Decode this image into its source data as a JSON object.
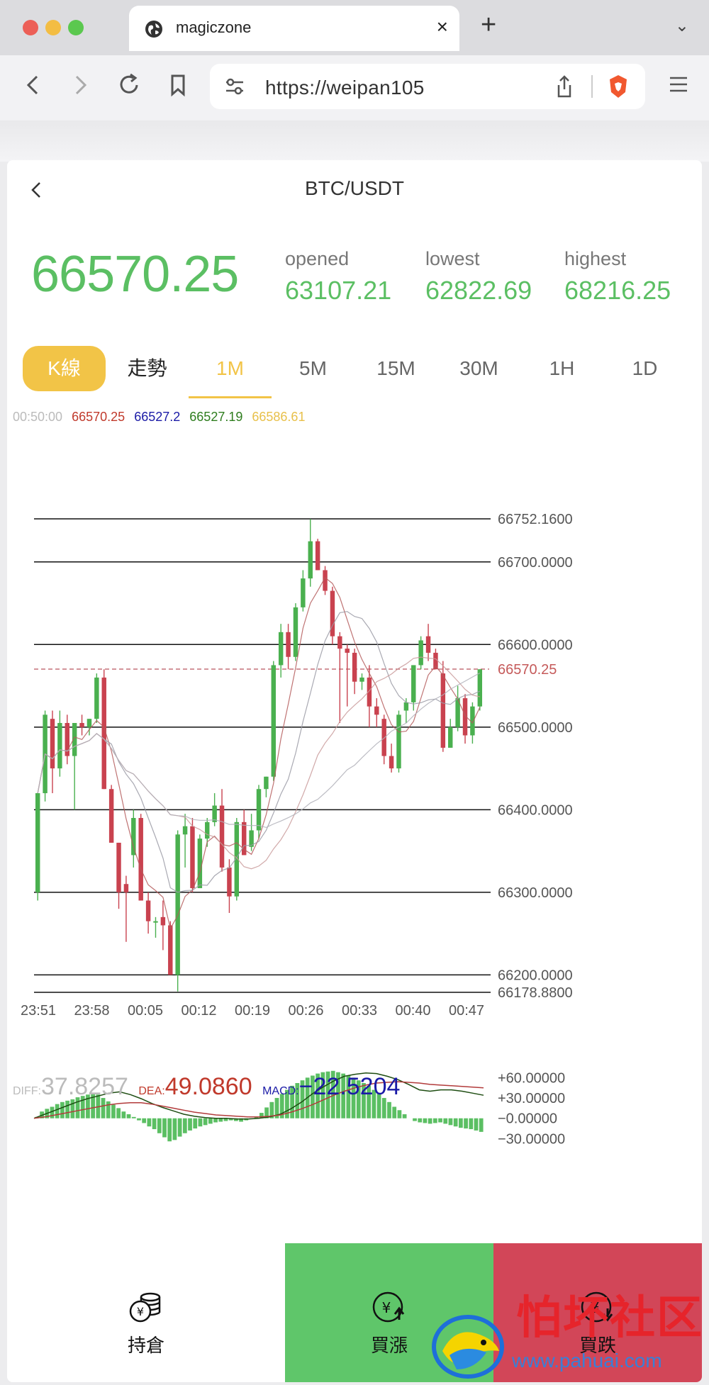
{
  "browser": {
    "tab_title": "magiczone",
    "tab_close": "×",
    "new_tab": "+",
    "tab_menu": "⌄",
    "url": "https://weipan105",
    "icons": [
      "globe-icon",
      "back-arrow-icon",
      "forward-arrow-icon",
      "reload-icon",
      "bookmark-icon",
      "site-settings-icon",
      "share-icon",
      "brave-shield-icon",
      "menu-icon"
    ],
    "traffic_colors": [
      "#ec5f57",
      "#f3bd43",
      "#5bc84f"
    ]
  },
  "header": {
    "title": "BTC/USDT",
    "back_icon": "chevron-left-icon"
  },
  "ticker": {
    "price": "66570.25",
    "opened_label": "opened",
    "opened": "63107.21",
    "lowest_label": "lowest",
    "lowest": "62822.69",
    "highest_label": "highest",
    "highest": "68216.25"
  },
  "periods": {
    "kline": "K線",
    "trend": "走勢",
    "m1": "1M",
    "m5": "5M",
    "m15": "15M",
    "m30": "30M",
    "h1": "1H",
    "d1": "1D",
    "active": "1M"
  },
  "ma_legend": {
    "time": "00:50:00",
    "v1": "66570.25",
    "v2": "66527.2",
    "v3": "66527.19",
    "v4": "66586.61"
  },
  "macd_legend": {
    "diff_label": "DIFF:",
    "diff": "37.8257",
    "dea_label": "DEA:",
    "dea": "49.0860",
    "macd_label": "MACD:",
    "macd": "−22.5204"
  },
  "bottom": {
    "hold": "持倉",
    "buy_up": "買漲",
    "buy_down": "買跌"
  },
  "watermark": {
    "text": "怕坏社区",
    "url": "www.pahuai.com"
  },
  "colors": {
    "up": "#5bbf63",
    "down": "#cf4b5a",
    "accent": "#f2c447",
    "ma1": "#c0392b",
    "ma2": "#1a1aa6",
    "ma3": "#2e7d1e",
    "ma4": "#e8c04a"
  },
  "chart_data": [
    {
      "type": "candlestick",
      "price_labels": [
        "66752.1600",
        "66700.0000",
        "66600.0000",
        "66570.25",
        "66500.0000",
        "66400.0000",
        "66300.0000",
        "66200.0000",
        "66178.8800"
      ],
      "price_lines": [
        66752.16,
        66700,
        66600,
        66500,
        66400,
        66300,
        66200,
        66178.88
      ],
      "ylim": [
        66178.88,
        66752.16
      ],
      "current_price": 66570.25,
      "x_tick_labels": [
        "23:51",
        "23:58",
        "00:05",
        "00:12",
        "00:19",
        "00:26",
        "00:33",
        "00:40",
        "00:47"
      ],
      "candles": [
        {
          "o": 66300,
          "h": 66410,
          "l": 66290,
          "c": 66420
        },
        {
          "o": 66420,
          "h": 66520,
          "l": 66410,
          "c": 66515
        },
        {
          "o": 66510,
          "h": 66520,
          "l": 66420,
          "c": 66450
        },
        {
          "o": 66450,
          "h": 66520,
          "l": 66440,
          "c": 66505
        },
        {
          "o": 66505,
          "h": 66515,
          "l": 66455,
          "c": 66465
        },
        {
          "o": 66465,
          "h": 66505,
          "l": 66400,
          "c": 66505
        },
        {
          "o": 66505,
          "h": 66515,
          "l": 66490,
          "c": 66500
        },
        {
          "o": 66500,
          "h": 66510,
          "l": 66490,
          "c": 66510
        },
        {
          "o": 66510,
          "h": 66565,
          "l": 66505,
          "c": 66560
        },
        {
          "o": 66560,
          "h": 66570,
          "l": 66425,
          "c": 66425
        },
        {
          "o": 66425,
          "h": 66430,
          "l": 66360,
          "c": 66360
        },
        {
          "o": 66360,
          "h": 66345,
          "l": 66280,
          "c": 66300
        },
        {
          "o": 66310,
          "h": 66320,
          "l": 66240,
          "c": 66300
        },
        {
          "o": 66345,
          "h": 66400,
          "l": 66330,
          "c": 66390
        },
        {
          "o": 66390,
          "h": 66395,
          "l": 66290,
          "c": 66290
        },
        {
          "o": 66290,
          "h": 66300,
          "l": 66250,
          "c": 66265
        },
        {
          "o": 66265,
          "h": 66270,
          "l": 66245,
          "c": 66265
        },
        {
          "o": 66270,
          "h": 66290,
          "l": 66230,
          "c": 66260
        },
        {
          "o": 66260,
          "h": 66265,
          "l": 66200,
          "c": 66200
        },
        {
          "o": 66200,
          "h": 66375,
          "l": 66180,
          "c": 66370
        },
        {
          "o": 66370,
          "h": 66395,
          "l": 66330,
          "c": 66380
        },
        {
          "o": 66380,
          "h": 66390,
          "l": 66300,
          "c": 66305
        },
        {
          "o": 66305,
          "h": 66370,
          "l": 66305,
          "c": 66365
        },
        {
          "o": 66365,
          "h": 66390,
          "l": 66355,
          "c": 66385
        },
        {
          "o": 66385,
          "h": 66420,
          "l": 66380,
          "c": 66405
        },
        {
          "o": 66405,
          "h": 66425,
          "l": 66325,
          "c": 66330
        },
        {
          "o": 66330,
          "h": 66340,
          "l": 66275,
          "c": 66295
        },
        {
          "o": 66295,
          "h": 66390,
          "l": 66290,
          "c": 66385
        },
        {
          "o": 66385,
          "h": 66400,
          "l": 66345,
          "c": 66345
        },
        {
          "o": 66355,
          "h": 66395,
          "l": 66350,
          "c": 66375
        },
        {
          "o": 66375,
          "h": 66430,
          "l": 66365,
          "c": 66425
        },
        {
          "o": 66425,
          "h": 66440,
          "l": 66415,
          "c": 66440
        },
        {
          "o": 66440,
          "h": 66580,
          "l": 66435,
          "c": 66575
        },
        {
          "o": 66575,
          "h": 66625,
          "l": 66560,
          "c": 66615
        },
        {
          "o": 66615,
          "h": 66625,
          "l": 66570,
          "c": 66585
        },
        {
          "o": 66585,
          "h": 66650,
          "l": 66580,
          "c": 66645
        },
        {
          "o": 66645,
          "h": 66690,
          "l": 66640,
          "c": 66680
        },
        {
          "o": 66680,
          "h": 66752,
          "l": 66670,
          "c": 66725
        },
        {
          "o": 66725,
          "h": 66728,
          "l": 66690,
          "c": 66690
        },
        {
          "o": 66690,
          "h": 66695,
          "l": 66660,
          "c": 66665
        },
        {
          "o": 66665,
          "h": 66670,
          "l": 66600,
          "c": 66610
        },
        {
          "o": 66610,
          "h": 66615,
          "l": 66505,
          "c": 66595
        },
        {
          "o": 66595,
          "h": 66600,
          "l": 66525,
          "c": 66590
        },
        {
          "o": 66590,
          "h": 66595,
          "l": 66540,
          "c": 66555
        },
        {
          "o": 66555,
          "h": 66565,
          "l": 66545,
          "c": 66560
        },
        {
          "o": 66560,
          "h": 66575,
          "l": 66500,
          "c": 66525
        },
        {
          "o": 66525,
          "h": 66535,
          "l": 66500,
          "c": 66515
        },
        {
          "o": 66510,
          "h": 66515,
          "l": 66455,
          "c": 66465
        },
        {
          "o": 66465,
          "h": 66480,
          "l": 66445,
          "c": 66450
        },
        {
          "o": 66450,
          "h": 66520,
          "l": 66445,
          "c": 66515
        },
        {
          "o": 66520,
          "h": 66535,
          "l": 66505,
          "c": 66530
        },
        {
          "o": 66530,
          "h": 66575,
          "l": 66520,
          "c": 66575
        },
        {
          "o": 66575,
          "h": 66610,
          "l": 66570,
          "c": 66605
        },
        {
          "o": 66610,
          "h": 66625,
          "l": 66580,
          "c": 66590
        },
        {
          "o": 66590,
          "h": 66595,
          "l": 66570,
          "c": 66570
        },
        {
          "o": 66565,
          "h": 66580,
          "l": 66470,
          "c": 66475
        },
        {
          "o": 66475,
          "h": 66510,
          "l": 66475,
          "c": 66500
        },
        {
          "o": 66500,
          "h": 66550,
          "l": 66495,
          "c": 66535
        },
        {
          "o": 66535,
          "h": 66540,
          "l": 66480,
          "c": 66490
        },
        {
          "o": 66490,
          "h": 66530,
          "l": 66480,
          "c": 66525
        },
        {
          "o": 66525,
          "h": 66570,
          "l": 66520,
          "c": 66570
        }
      ]
    },
    {
      "type": "bar",
      "title": "MACD",
      "y_tick_labels": [
        "+60.00000",
        "+30.00000",
        "−0.00000",
        "−30.00000"
      ],
      "ylim": [
        -40,
        75
      ],
      "histogram": [
        2,
        10,
        14,
        17,
        21,
        24,
        26,
        28,
        31,
        33,
        35,
        37,
        35,
        30,
        25,
        20,
        15,
        10,
        6,
        2,
        -3,
        -7,
        -12,
        -16,
        -22,
        -28,
        -34,
        -32,
        -27,
        -22,
        -18,
        -15,
        -12,
        -10,
        -8,
        -6,
        -5,
        -4,
        -3,
        -4,
        -5,
        -3,
        -1,
        2,
        8,
        16,
        24,
        30,
        36,
        42,
        48,
        52,
        56,
        60,
        63,
        66,
        68,
        69,
        70,
        68,
        66,
        63,
        60,
        56,
        52,
        48,
        42,
        36,
        30,
        24,
        17,
        12,
        6,
        0,
        -4,
        -6,
        -7,
        -8,
        -7,
        -6,
        -8,
        -10,
        -12,
        -14,
        -15,
        -16,
        -18,
        -20
      ],
      "diff_line": [
        0,
        6,
        12,
        18,
        24,
        29,
        33,
        37,
        39,
        35,
        29,
        22,
        16,
        11,
        6,
        3,
        1,
        0,
        0,
        -1,
        -1,
        0,
        2,
        6,
        14,
        24,
        36,
        46,
        55,
        62,
        65,
        67,
        66,
        62,
        57,
        50,
        42,
        40,
        42,
        42,
        40,
        37,
        34
      ],
      "dea_line": [
        0,
        2,
        5,
        8,
        11,
        14,
        17,
        20,
        22,
        23,
        23,
        21,
        18,
        15,
        12,
        9,
        7,
        5,
        4,
        3,
        2,
        2,
        3,
        5,
        9,
        14,
        20,
        27,
        34,
        40,
        45,
        49,
        52,
        53,
        54,
        53,
        52,
        50,
        49,
        48,
        47,
        46,
        45
      ]
    }
  ]
}
